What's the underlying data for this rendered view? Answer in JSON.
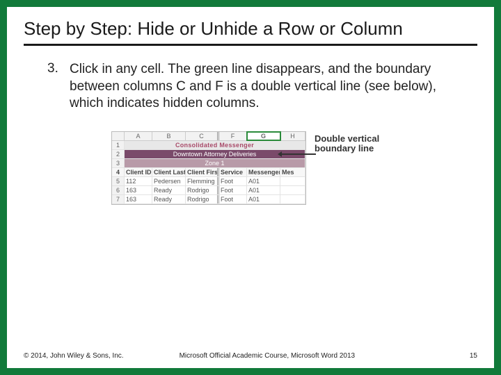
{
  "title": "Step by Step: Hide or Unhide a Row or Column",
  "step_number": "3.",
  "step_text": "Click in any cell. The green line disappears, and the boundary between columns C and F is a double vertical line (see below), which indicates hidden columns.",
  "sheet": {
    "cols": [
      "A",
      "B",
      "C",
      "F",
      "G",
      "H"
    ],
    "title_row": "Consolidated Messenger",
    "subtitle_row": "Downtown Attorney Deliveries",
    "zone_row": "Zone 1",
    "headers": [
      "Client ID",
      "Client Last",
      "Client First",
      "Service",
      "Messenger ID",
      "Mes"
    ],
    "rows": [
      [
        "112",
        "Pedersen",
        "Flemming",
        "Foot",
        "A01",
        ""
      ],
      [
        "163",
        "Ready",
        "Rodrigo",
        "Foot",
        "A01",
        ""
      ],
      [
        "163",
        "Ready",
        "Rodrigo",
        "Foot",
        "A01",
        ""
      ]
    ],
    "row_nums": [
      "1",
      "2",
      "3",
      "4",
      "5",
      "6",
      "7"
    ]
  },
  "callout": "Double vertical boundary line",
  "footer": {
    "copyright": "© 2014, John Wiley & Sons, Inc.",
    "course": "Microsoft Official Academic Course, Microsoft Word 2013",
    "page": "15"
  }
}
